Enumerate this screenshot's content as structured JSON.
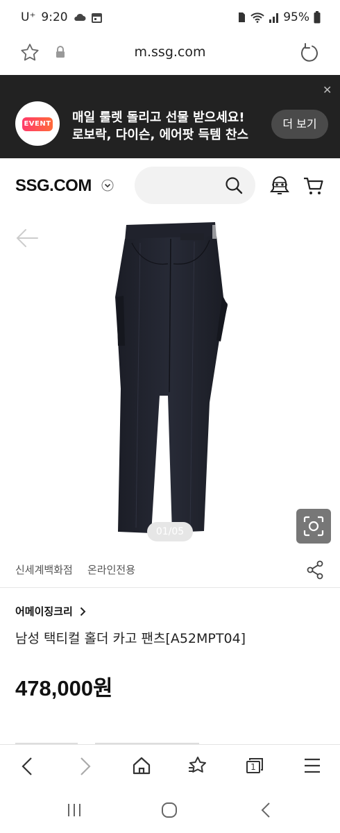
{
  "status_bar": {
    "carrier": "U⁺",
    "time": "9:20",
    "battery": "95%"
  },
  "address_bar": {
    "url": "m.ssg.com"
  },
  "event_banner": {
    "badge": "EVENT",
    "line1": "매일 룰렛 돌리고 선물 받으세요!",
    "line2": "로보락, 다이슨, 에어팟 득템 찬스",
    "more_label": "더 보기",
    "colors": {
      "background": "#222222",
      "button": "#4a4a4a"
    }
  },
  "site_header": {
    "logo": "SSG.COM",
    "icons": [
      "chevron-down-icon",
      "search-icon",
      "bell-robot-icon",
      "cart-icon"
    ]
  },
  "gallery": {
    "counter": "01/05"
  },
  "product": {
    "store": "신세계백화점",
    "tag": "온라인전용",
    "brand": "어메이징크리",
    "name": "남성 택티컬 홀더 카고 팬츠[A52MPT04]",
    "price": "478,000원"
  },
  "browser_nav": {
    "tab_count": "1"
  }
}
